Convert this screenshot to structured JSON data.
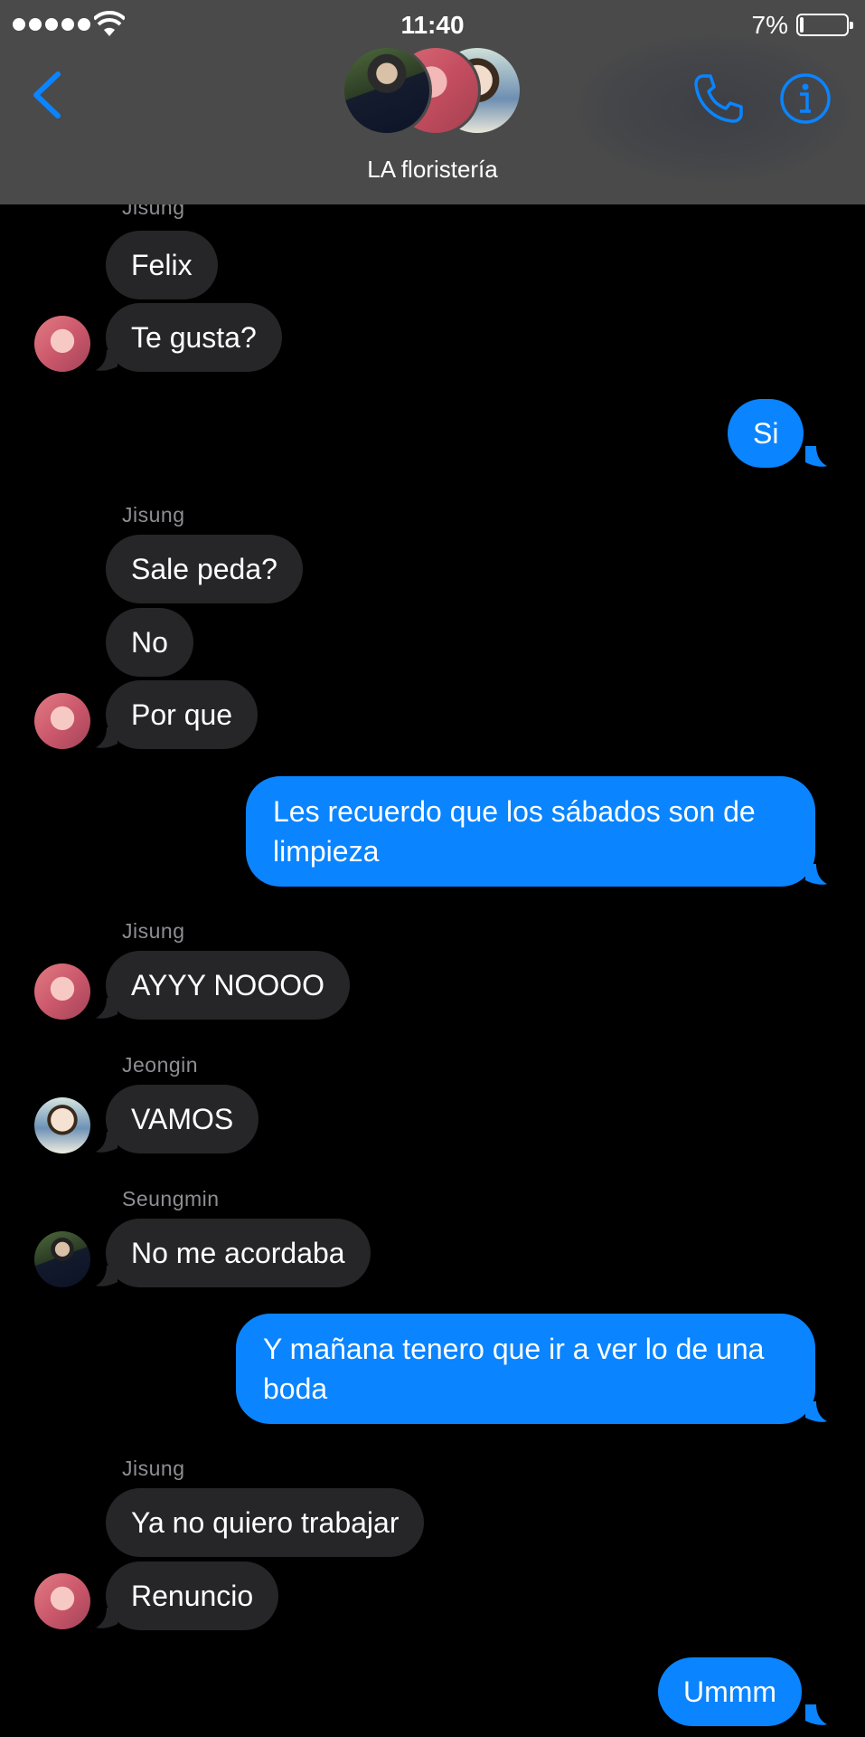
{
  "status_bar": {
    "time": "11:40",
    "battery": "7%",
    "battery_level": 0.07
  },
  "header": {
    "group_name": "LA floristería"
  },
  "messages": {
    "s1": {
      "sender": "Jisung"
    },
    "m1": {
      "text": "Felix"
    },
    "m2": {
      "text": "Te gusta?"
    },
    "m3": {
      "text": "Si"
    },
    "s2": {
      "sender": "Jisung"
    },
    "m4": {
      "text": "Sale peda?"
    },
    "m5": {
      "text": "No"
    },
    "m6": {
      "text": "Por que"
    },
    "m7": {
      "text": "Les recuerdo que los sábados son de limpieza"
    },
    "s3": {
      "sender": "Jisung"
    },
    "m8": {
      "text": "AYYY NOOOO"
    },
    "s4": {
      "sender": "Jeongin"
    },
    "m9": {
      "text": "VAMOS"
    },
    "s5": {
      "sender": "Seungmin"
    },
    "m10": {
      "text": "No me acordaba"
    },
    "m11": {
      "text": "Y mañana tenero que ir a ver lo de una boda"
    },
    "s6": {
      "sender": "Jisung"
    },
    "m12": {
      "text": "Ya no quiero trabajar"
    },
    "m13": {
      "text": "Renuncio"
    },
    "m14": {
      "text": "Ummm"
    }
  },
  "colors": {
    "sent_bubble": "#0a84ff",
    "received_bubble": "#262628",
    "accent": "#0a84ff",
    "header_bg": "#4a4a4a"
  },
  "icons": [
    "signal-dots-icon",
    "wifi-icon",
    "battery-icon",
    "back-chevron-icon",
    "phone-icon",
    "info-icon"
  ]
}
